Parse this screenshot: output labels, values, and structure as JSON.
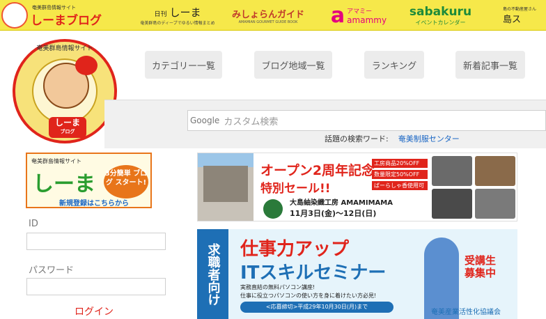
{
  "topbar": {
    "shima_logo_small": "奄美群島情報サイト",
    "shima_logo_big": "しーまブログ",
    "nikkan_prefix": "日刊",
    "nikkan_title": "しーま",
    "nikkan_sub": "奄美群島のディープでゆるい情報まとめ",
    "mishoran_title": "みしょらんガイド",
    "mishoran_sub": "AMAMIAN GOURMET GUIDE BOOK",
    "amammy_icon": "a",
    "amammy_kana": "アマミー",
    "amammy_title": "amammy",
    "sabakuru_title": "sabakuru",
    "sabakuru_sub": "イベントカレンダー",
    "fudosan_small": "島の不動産屋さん",
    "fudosan_title": "島ス"
  },
  "logo": {
    "ring_text": "奄美群島情報サイト",
    "name": "しーま",
    "sub": "ブログ"
  },
  "nav": [
    {
      "label": "カテゴリー一覧"
    },
    {
      "label": "ブログ地域一覧"
    },
    {
      "label": "ランキング"
    },
    {
      "label": "新着記事一覧"
    }
  ],
  "search": {
    "brand": "Google",
    "placeholder": "カスタム検索",
    "keyword_label": "話題の検索ワード:",
    "keyword": "奄美制服センター"
  },
  "register_banner": {
    "line1": "奄美群島情報サイト",
    "name": "しーま",
    "badge": "3分簡単 ブログ スタート!",
    "cta": "新規登録はこちらから"
  },
  "login": {
    "id_label": "ID",
    "password_label": "パスワード",
    "button": "ログイン"
  },
  "ad1": {
    "headline": "オープン2周年記念",
    "sale": "特別セール!!",
    "tags": [
      "工房商品20%OFF",
      "数量限定50%OFF",
      "ばーらしゃ香使用可"
    ],
    "shop": "大島紬染織工房 AMAMIMAMA",
    "date": "11月3日(金)〜12日(日)"
  },
  "ad2": {
    "side": "求職者向け",
    "headline": "仕事力アップ",
    "title": "ITスキルセミナー",
    "sub1": "実務直結の無料パソコン講座!",
    "sub2": "仕事に役立つパソコンの使い方を身に着けたい方必見!",
    "deadline": "<応募締切>平成29年10月30日(月)まで",
    "badge1": "受講生",
    "badge2": "募集中",
    "org": "奄美産業活性化協議会"
  },
  "colors": {
    "accent": "#e0241b",
    "topbar": "#f6e84a",
    "link": "#1a66c4"
  }
}
